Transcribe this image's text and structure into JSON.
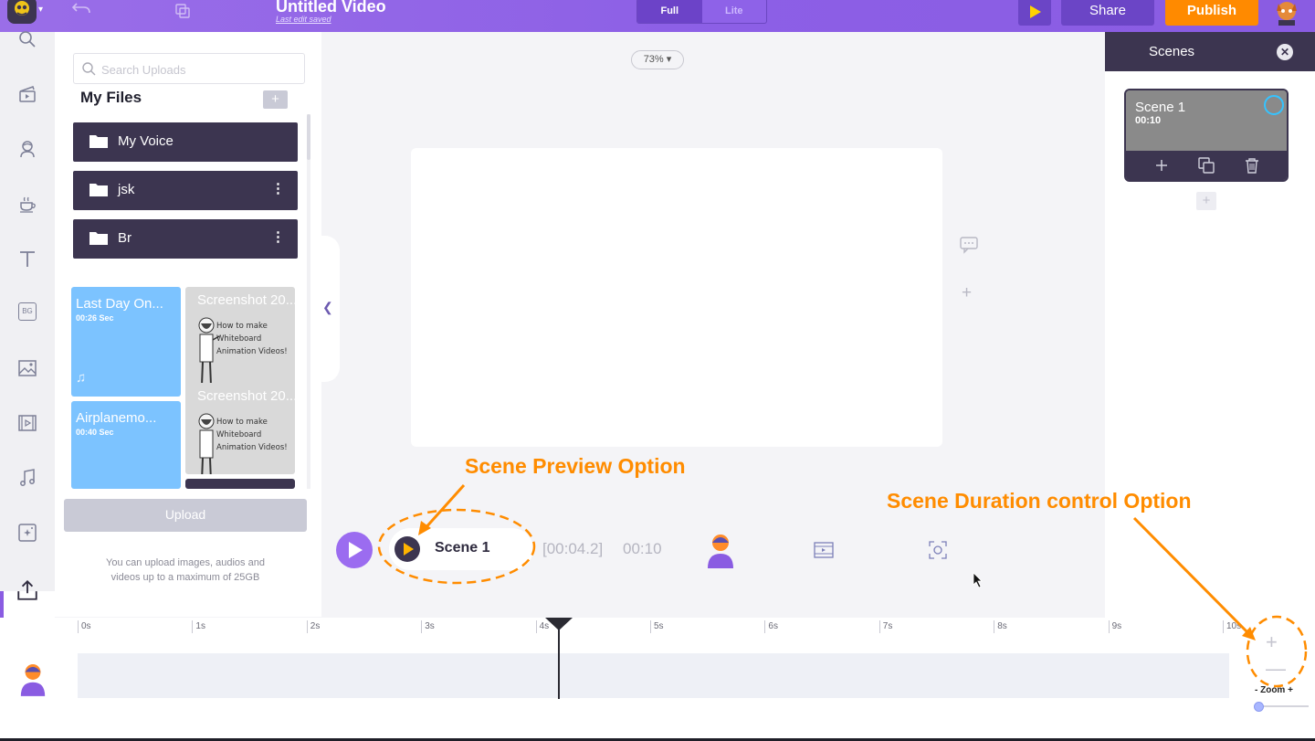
{
  "header": {
    "title": "Untitled Video",
    "subtitle": "Last edit saved",
    "view_modes": [
      "Full",
      "Lite"
    ],
    "active_view": "Full",
    "share_label": "Share",
    "publish_label": "Publish",
    "colors": {
      "brand": "#8c5fe6",
      "publish": "#ff8a00",
      "dark": "#3c3550"
    }
  },
  "rail": {
    "icons": [
      "search-icon",
      "scene-clapper-icon",
      "character-icon",
      "props-cup-icon",
      "text-icon",
      "bg-icon",
      "image-icon",
      "video-icon",
      "music-icon",
      "effects-icon",
      "upload-icon"
    ],
    "bg_label": "BG",
    "active": "upload-icon"
  },
  "uploads": {
    "search_placeholder": "Search Uploads",
    "heading": "My Files",
    "new_folder_symbol": "+",
    "folders": [
      {
        "name": "My Voice",
        "menu": ""
      },
      {
        "name": "jsk",
        "menu": "⋮"
      },
      {
        "name": "Br",
        "menu": "⋮"
      }
    ],
    "media": [
      {
        "name": "Last Day On...",
        "duration": "00:26 Sec",
        "kind": "audio",
        "note": "♫"
      },
      {
        "name": "Screenshot 20...",
        "kind": "image",
        "caption_line1": "How to make",
        "caption_line2": "Whiteboard Animation Videos!"
      },
      {
        "name": "Airplanemo...",
        "duration": "00:40 Sec",
        "kind": "audio",
        "note": "♫"
      },
      {
        "name": "Screenshot 20...",
        "kind": "image",
        "caption_line1": "How to make",
        "caption_line2": "Whiteboard Animation Videos!"
      }
    ],
    "upload_label": "Upload",
    "upload_note": "You can upload images, audios and videos up to a maximum of 25GB"
  },
  "canvas": {
    "zoom_level": "73%",
    "zoom_caret": "▾",
    "side_plus": "+"
  },
  "scene_strip": {
    "scene_name": "Scene 1",
    "current_time": "[00:04.2]",
    "total_time": "00:10"
  },
  "annotations": {
    "preview": "Scene Preview Option",
    "duration": "Scene Duration control Option"
  },
  "scenes_panel": {
    "title": "Scenes",
    "close_symbol": "✕",
    "add_symbol": "+",
    "scenes": [
      {
        "name": "Scene 1",
        "duration": "00:10"
      }
    ]
  },
  "timeline": {
    "ticks": [
      "0s",
      "1s",
      "2s",
      "3s",
      "4s",
      "5s",
      "6s",
      "7s",
      "8s",
      "9s",
      "10s"
    ],
    "zoom_label": "-  Zoom  +",
    "zoom_in": "+",
    "zoom_out": "—",
    "zoom_fraction": 0.0,
    "playhead_seconds": 4.2
  }
}
